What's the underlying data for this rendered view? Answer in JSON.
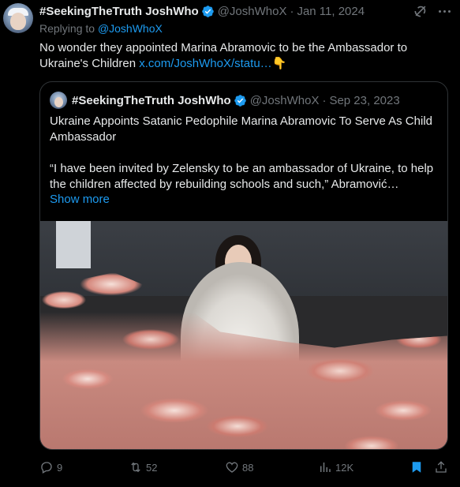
{
  "post": {
    "author_name": "#SeekingTheTruth JoshWho",
    "handle": "@JoshWhoX",
    "separator": "·",
    "date": "Jan 11, 2024",
    "replying_prefix": "Replying to",
    "replying_mention": "@JoshWhoX",
    "text": "No wonder they appointed Marina Abramovic to be the Ambassador to Ukraine's Children",
    "link": "x.com/JoshWhoX/statu…",
    "emoji": "👇"
  },
  "quote": {
    "author_name": "#SeekingTheTruth JoshWho",
    "handle": "@JoshWhoX",
    "separator": "·",
    "date": "Sep 23, 2023",
    "line1": "Ukraine Appoints Satanic Pedophile Marina Abramovic To Serve As Child Ambassador",
    "line2": "“I have been invited by Zelensky to be an ambassador of Ukraine, to help the children affected by rebuilding schools and such,” Abramović…",
    "show_more": "Show more"
  },
  "actions": {
    "replies": "9",
    "reposts": "52",
    "likes": "88",
    "views": "12K"
  },
  "colors": {
    "background": "#000000",
    "text": "#e7e9ea",
    "muted": "#71767b",
    "accent": "#1d9bf0",
    "border": "#2f3336"
  },
  "icons": [
    "verified-badge-icon",
    "grok-icon",
    "more-icon",
    "reply-icon",
    "repost-icon",
    "like-icon",
    "views-icon",
    "bookmark-icon",
    "share-icon"
  ]
}
